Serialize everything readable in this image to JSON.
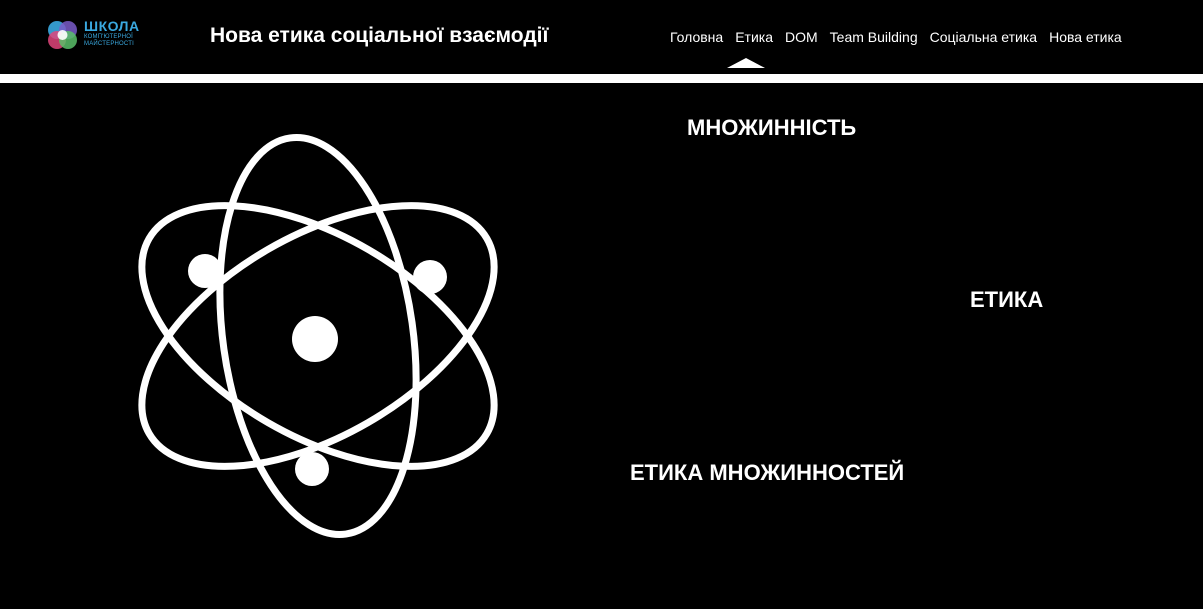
{
  "header": {
    "logo": {
      "line1": "ШКОЛА",
      "line2": "КОМП'ЮТЕРНОЇ",
      "line3": "МАЙСТЕРНОСТІ",
      "icon": "school-logo-icon",
      "colors": [
        "#3aa9e0",
        "#e0457b",
        "#5bbf6a",
        "#7a5cc9"
      ]
    },
    "title": "Нова етика соціальної взаємодії",
    "nav": {
      "items": [
        {
          "label": "Головна"
        },
        {
          "label": "Етика"
        },
        {
          "label": "DOM"
        },
        {
          "label": "Team Building"
        },
        {
          "label": "Соціальна етика"
        },
        {
          "label": "Нова етика"
        }
      ],
      "active": "Етика"
    }
  },
  "main": {
    "illustration": "atom-icon",
    "terms": {
      "t1": "МНОЖИННІСТЬ",
      "t2": "ЕТИКА",
      "t3": "ЕТИКА МНОЖИННОСТЕЙ"
    }
  },
  "colors": {
    "background": "#000000",
    "text": "#ffffff",
    "divider": "#ffffff"
  }
}
